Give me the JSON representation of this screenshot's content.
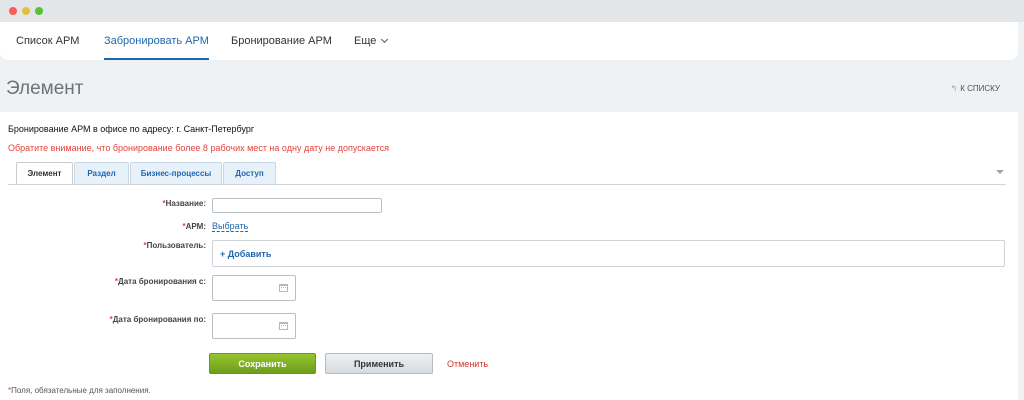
{
  "topnav": {
    "tabs": [
      {
        "label": "Список АРМ"
      },
      {
        "label": "Забронировать АРМ"
      },
      {
        "label": "Бронирование АРМ"
      },
      {
        "label": "Еще"
      }
    ]
  },
  "header": {
    "title": "Элемент",
    "back_link": "К СПИСКУ",
    "back_arrow": "↰"
  },
  "info": {
    "address": "Бронирование АРМ в офисе по адресу: г. Санкт-Петербург",
    "warning": "Обратите внимание, что бронирование более 8 рабочих мест на одну дату не допускается"
  },
  "form_tabs": [
    {
      "label": "Элемент"
    },
    {
      "label": "Раздел"
    },
    {
      "label": "Бизнес-процессы"
    },
    {
      "label": "Доступ"
    }
  ],
  "form": {
    "required_mark": "*",
    "name_label": "Название:",
    "name_value": "",
    "arm_label": "АРМ:",
    "arm_link": "Выбрать",
    "user_label": "Пользователь:",
    "user_add": "+ Добавить",
    "date_from_label": "Дата бронирования с:",
    "date_from_value": "",
    "date_to_label": "Дата бронирования по:",
    "date_to_value": "",
    "icons": {
      "date": "calendar-icon",
      "collapse": "triangle-down-icon",
      "back": "return-arrow-icon"
    }
  },
  "actions": {
    "save": "Сохранить",
    "apply": "Применить",
    "cancel": "Отменить"
  },
  "footer": {
    "required_note": "Поля, обязательные для заполнения."
  },
  "colors": {
    "accent": "#2067b0",
    "warning": "#e4433d",
    "save_button": "#7fb124"
  }
}
